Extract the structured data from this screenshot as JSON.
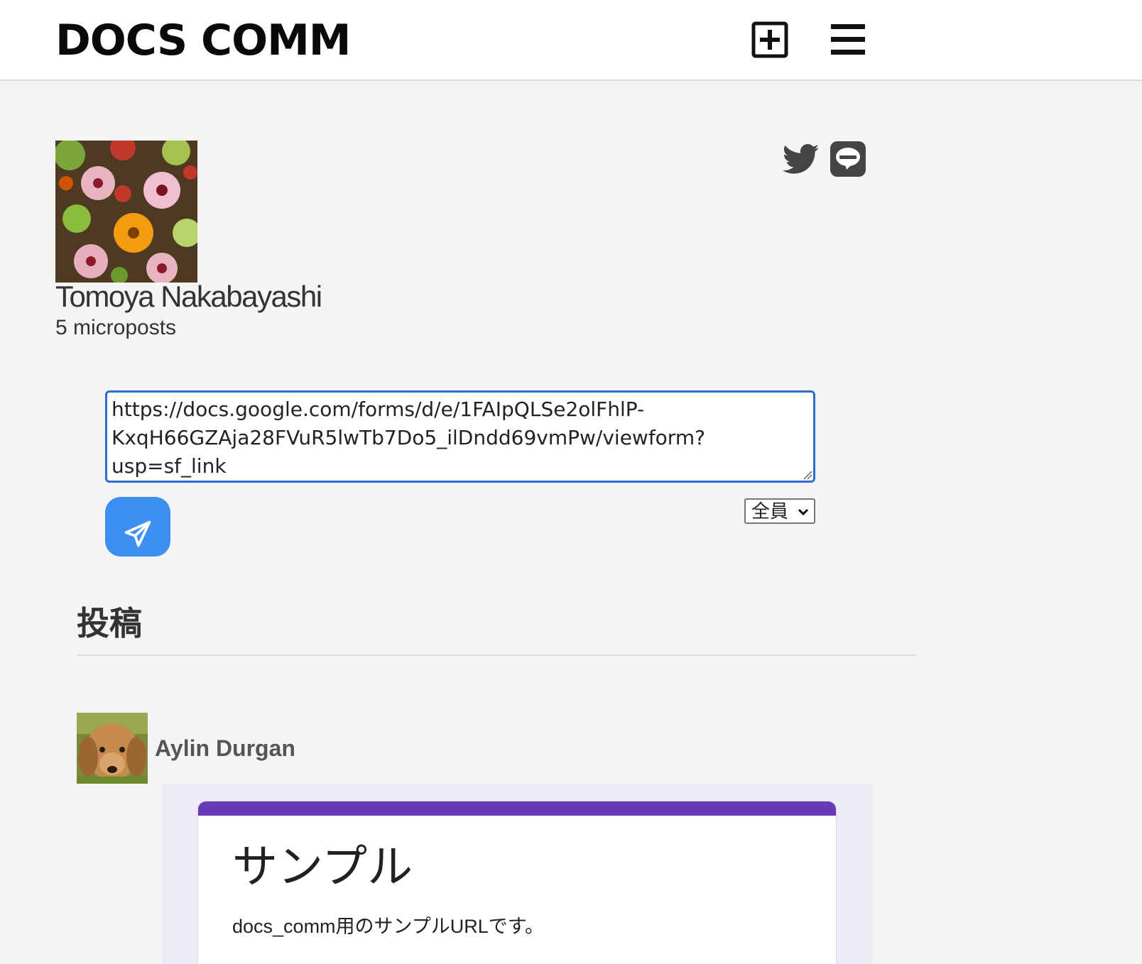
{
  "header": {
    "logo": "DOCS COMM",
    "new_post_icon": "plus-square-icon",
    "menu_icon": "hamburger-menu-icon"
  },
  "profile": {
    "name": "Tomoya Nakabayashi",
    "post_count": "5 microposts",
    "image": "flower-photo",
    "share": [
      "twitter-icon",
      "line-icon"
    ]
  },
  "composer": {
    "value": "https://docs.google.com/forms/d/e/1FAIpQLSe2olFhlP-KxqH66GZAja28FVuR5lwTb7Do5_ilDndd69vmPw/viewform?usp=sf_link",
    "audience": "全員",
    "send_icon": "paper-plane-icon"
  },
  "feed": {
    "title": "投稿",
    "posts": [
      {
        "author": "Aylin Durgan",
        "avatar": "dog-photo",
        "embed": {
          "title": "サンプル",
          "description": "docs_comm用のサンプルURLです。"
        }
      }
    ]
  },
  "colors": {
    "page_bg": "#f4f4f4",
    "header_bg": "#ffffff",
    "accent_blue": "#3d8ff0",
    "focus_border": "#2f6cd0",
    "form_purple": "#673ab7",
    "form_bg": "#efebf6"
  }
}
